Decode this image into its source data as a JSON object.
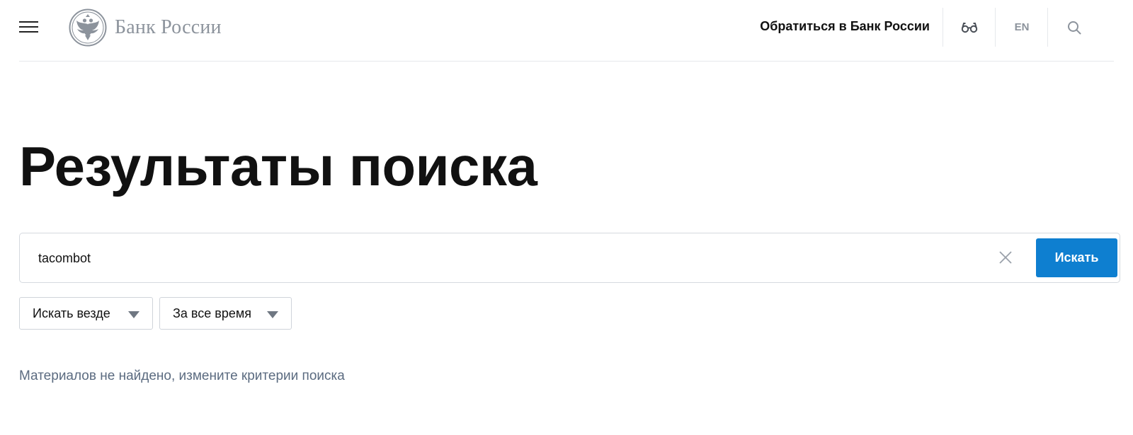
{
  "header": {
    "menu_icon": "burger-menu-icon",
    "logo": {
      "emblem_icon": "double-headed-eagle-icon",
      "text": "Банк России"
    },
    "contact_link": "Обратиться в Банк России",
    "accessibility_icon": "glasses-icon",
    "language": "EN",
    "search_icon": "search-icon"
  },
  "main": {
    "title": "Результаты поиска",
    "search": {
      "value": "tacombot",
      "clear_icon": "close-icon",
      "button_label": "Искать"
    },
    "filters": [
      {
        "label": "Искать везде",
        "icon": "caret-down-icon"
      },
      {
        "label": "За все время",
        "icon": "caret-down-icon"
      }
    ],
    "empty_message": "Материалов не найдено, измените критерии поиска"
  },
  "colors": {
    "accent": "#0e7fd0",
    "muted_text": "#5b6b80",
    "logo_gray": "#8c939c",
    "border": "#d5d9df"
  }
}
